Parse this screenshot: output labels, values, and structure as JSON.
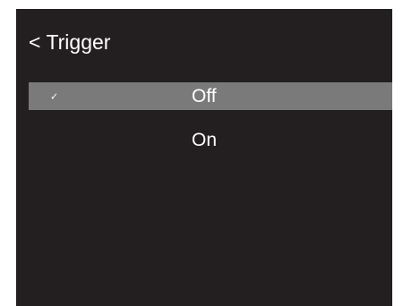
{
  "header": {
    "back_icon": "<",
    "title": "Trigger"
  },
  "menu": {
    "items": [
      {
        "label": "Off",
        "selected": true,
        "check_icon": "✓"
      },
      {
        "label": "On",
        "selected": false,
        "check_icon": ""
      }
    ]
  },
  "colors": {
    "screen_background": "#231f20",
    "selected_background": "#7a7a7a",
    "text": "#ffffff"
  }
}
